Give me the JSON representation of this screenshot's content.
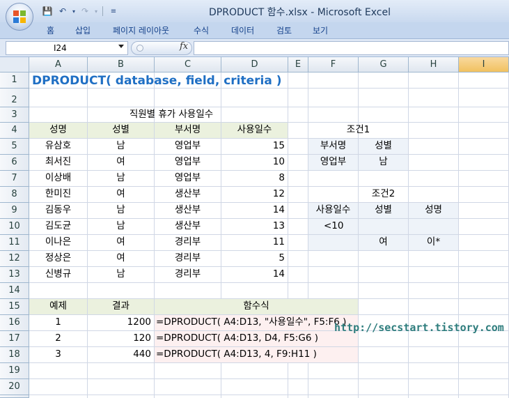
{
  "window": {
    "title": "DPRODUCT 함수.xlsx - Microsoft Excel"
  },
  "ribbon": {
    "tabs": [
      "홈",
      "삽입",
      "페이지 레이아웃",
      "수식",
      "데이터",
      "검토",
      "보기"
    ]
  },
  "formula_bar": {
    "name_box": "I24",
    "fx": "fx",
    "formula": ""
  },
  "columns": [
    "A",
    "B",
    "C",
    "D",
    "E",
    "F",
    "G",
    "H",
    "I"
  ],
  "selected_column": "I",
  "rows": [
    "1",
    "2",
    "3",
    "4",
    "5",
    "6",
    "7",
    "8",
    "9",
    "10",
    "11",
    "12",
    "13",
    "14",
    "15",
    "16",
    "17",
    "18",
    "19",
    "20",
    "21"
  ],
  "sheet": {
    "title": "DPRODUCT( database, field, criteria )",
    "table_caption": "직원별 휴가 사용일수",
    "headers": [
      "성명",
      "성별",
      "부서명",
      "사용일수"
    ],
    "employees": [
      [
        "유삼호",
        "남",
        "영업부",
        "15"
      ],
      [
        "최서진",
        "여",
        "영업부",
        "10"
      ],
      [
        "이상배",
        "남",
        "영업부",
        "8"
      ],
      [
        "한미진",
        "여",
        "생산부",
        "12"
      ],
      [
        "김동우",
        "남",
        "생산부",
        "14"
      ],
      [
        "김도균",
        "남",
        "생산부",
        "13"
      ],
      [
        "이나은",
        "여",
        "경리부",
        "11"
      ],
      [
        "정상은",
        "여",
        "경리부",
        "5"
      ],
      [
        "신병규",
        "남",
        "경리부",
        "14"
      ]
    ],
    "criteria1": {
      "label": "조건1",
      "headers": [
        "부서명",
        "성별"
      ],
      "values": [
        "영업부",
        "남"
      ]
    },
    "criteria2": {
      "label": "조건2",
      "headers": [
        "사용일수",
        "성별",
        "성명"
      ],
      "row1": [
        "<10",
        "",
        ""
      ],
      "row2": [
        "",
        "여",
        "이*"
      ]
    },
    "examples": {
      "headers": [
        "예제",
        "결과",
        "함수식"
      ],
      "rows": [
        [
          "1",
          "1200",
          "=DPRODUCT( A4:D13, \"사용일수\", F5:F6 )"
        ],
        [
          "2",
          "120",
          "=DPRODUCT( A4:D13, D4, F5:G6 )"
        ],
        [
          "3",
          "440",
          "=DPRODUCT( A4:D13, 4, F9:H11 )"
        ]
      ]
    }
  },
  "watermark": "http://secstart.tistory.com",
  "colors": {
    "title_blue": "#1f6fc4",
    "header_green": "#ebf1de",
    "formula_pink": "#fdf0f0",
    "criteria_blue": "#eef3f9",
    "selected_col": "#f1c15f"
  }
}
